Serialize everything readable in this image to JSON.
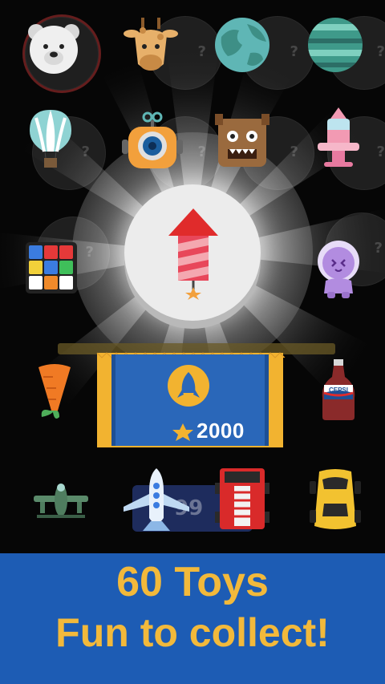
{
  "reward": {
    "price_value": "2000",
    "ghost_price": "99"
  },
  "banner": {
    "line1": "60 Toys",
    "line2": "Fun to collect!"
  },
  "toys": [
    {
      "name": "polar-bear-icon"
    },
    {
      "name": "giraffe-icon"
    },
    {
      "name": "earth-planet-icon"
    },
    {
      "name": "striped-planet-icon"
    },
    {
      "name": "hot-air-balloon-icon"
    },
    {
      "name": "camera-robot-icon"
    },
    {
      "name": "monster-box-icon"
    },
    {
      "name": "pink-rocket-toy-icon"
    },
    {
      "name": "rubiks-cube-icon"
    },
    {
      "name": "purple-alien-icon"
    },
    {
      "name": "carrot-icon"
    },
    {
      "name": "cola-bottle-icon"
    },
    {
      "name": "green-airplane-icon"
    },
    {
      "name": "jet-plane-icon"
    },
    {
      "name": "fire-truck-icon"
    },
    {
      "name": "yellow-car-icon"
    }
  ],
  "colors": {
    "banner_bg": "#1d5cb4",
    "banner_text": "#f2b93b",
    "sticker_blue": "#2a67b9",
    "sticker_gold": "#f2b330"
  }
}
